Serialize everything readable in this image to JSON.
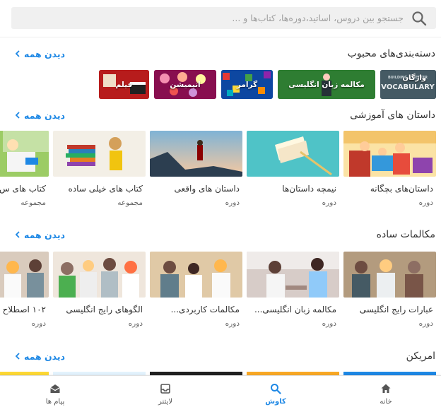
{
  "search": {
    "placeholder": "جستجو بین دروس، اساتید،دوره‌ها، کتاب‌ها و ..."
  },
  "sections": [
    {
      "title": "دسته‌بندی‌های محبوب",
      "see_all": "دیدن همه"
    },
    {
      "title": "داستان های آموزشی",
      "see_all": "دیدن همه"
    },
    {
      "title": "مکالمات ساده",
      "see_all": "دیدن همه"
    },
    {
      "title": "امریکن",
      "see_all": "دیدن همه"
    }
  ],
  "categories": [
    {
      "label": "واژگان",
      "art": "BUILDING A BETTER VOCABULARY",
      "color": "#37474f"
    },
    {
      "label": "مکالمه زبان انگلیسی",
      "color": "#2e7d32"
    },
    {
      "label": "گرامر",
      "color": "#1565c0"
    },
    {
      "label": "انیمیشن",
      "color": "#ad1457"
    },
    {
      "label": "فیلم",
      "color": "#8d1b1b"
    }
  ],
  "stories": [
    {
      "title": "داستان‌های بچگانه",
      "type": "دوره"
    },
    {
      "title": "نیمچه داستان‌ها",
      "type": "دوره"
    },
    {
      "title": "داستان های واقعی",
      "type": "دوره"
    },
    {
      "title": "کتاب های خیلی ساده",
      "type": "مجموعه"
    },
    {
      "title": "کتاب های س",
      "type": "مجموعه"
    }
  ],
  "conversations": [
    {
      "title": "عبارات رایج انگلیسی",
      "type": "دوره"
    },
    {
      "title": "مکالمه زبان انگلیسی...",
      "type": "دوره"
    },
    {
      "title": "مکالمات کاربردی...",
      "type": "دوره"
    },
    {
      "title": "الگوهای رایج انگلیسی",
      "type": "دوره"
    },
    {
      "title": "۱۰۲ اصطلاح",
      "type": "دوره"
    }
  ],
  "nav": [
    {
      "label": "خانه",
      "icon": "home-icon",
      "active": false
    },
    {
      "label": "کاوش",
      "icon": "search-icon",
      "active": true
    },
    {
      "label": "لایتنر",
      "icon": "inbox-icon",
      "active": false
    },
    {
      "label": "پیام ها",
      "icon": "mail-open-icon",
      "active": false
    }
  ],
  "colors": {
    "accent": "#1e88e5",
    "text": "#333333",
    "muted": "#666666",
    "search_bg": "#f0f0f0"
  }
}
